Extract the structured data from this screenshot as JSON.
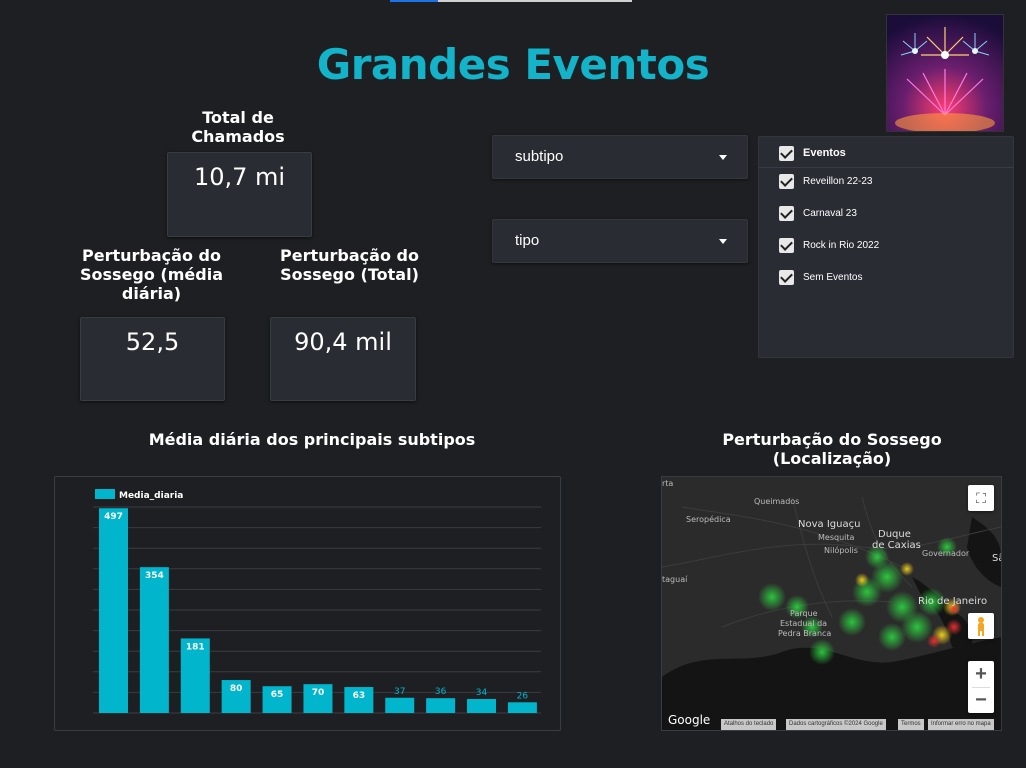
{
  "header": {
    "title": "Grandes Eventos"
  },
  "kpis": {
    "total": {
      "label": "Total de Chamados",
      "value": "10,7 mi"
    },
    "media": {
      "label": "Perturbação do Sossego (média diária)",
      "value": "52,5"
    },
    "totalPert": {
      "label": "Perturbação do Sossego (Total)",
      "value": "90,4 mil"
    }
  },
  "filters": {
    "subtipo": {
      "label": "subtipo"
    },
    "tipo": {
      "label": "tipo"
    }
  },
  "events": {
    "header": "Eventos",
    "items": [
      "Reveillon 22-23",
      "Carnaval 23",
      "Rock in Rio 2022",
      "Sem Eventos"
    ]
  },
  "chart_section": {
    "title": "Média diária dos principais subtipos"
  },
  "map_section": {
    "title_line1": "Perturbação do Sossego",
    "title_line2": "(Localização)",
    "labels": {
      "queimados": "Queimados",
      "nova_iguacu": "Nova Iguaçu",
      "mesquita": "Mesquita",
      "nilopolis": "Nilópolis",
      "duque": "Duque",
      "de_caxias": "de Caxias",
      "rio": "Rio de Janeiro",
      "parque1": "Parque",
      "parque2": "Estadual da",
      "parque3": "Pedra Branca",
      "seropedica": "Seropédica",
      "itaguai": "taguaí",
      "torta": "rta",
      "sg": "Sã",
      "gov": "Governador"
    },
    "google": "Google",
    "attribution": [
      "Atalhos do teclado",
      "Dados cartográficos ©2024 Google",
      "Termos",
      "Informar erro no mapa"
    ],
    "zoom_in": "+",
    "zoom_out": "−"
  },
  "colors": {
    "accent": "#13b3c9",
    "bar": "#00b5cc",
    "background": "#1e1f22"
  },
  "chart_data": {
    "type": "bar",
    "categories": [
      "",
      "",
      "",
      "",
      "",
      "",
      "",
      "",
      "",
      "",
      ""
    ],
    "series": [
      {
        "name": "Media_diaria",
        "values": [
          497,
          354,
          181,
          80,
          65,
          70,
          63,
          37,
          36,
          34,
          26
        ]
      }
    ],
    "title": "Média diária dos principais subtipos",
    "xlabel": "",
    "ylabel": "",
    "ylim": [
      0,
      500
    ],
    "grid": true,
    "legend": "top-left"
  }
}
